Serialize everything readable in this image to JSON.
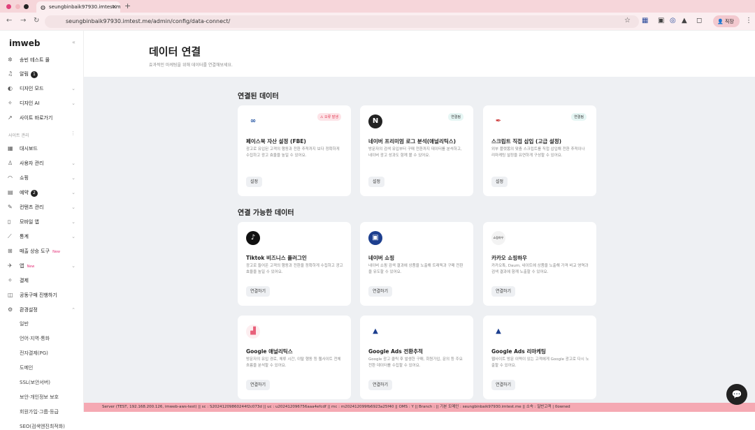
{
  "browser": {
    "tab_title": "seungbinbaik97930.imtest.me",
    "url": "seungbinbaik97930.imtest.me/admin/config/data-connect/",
    "profile": "직장"
  },
  "sidebar": {
    "logo": "imweb",
    "top_items": [
      {
        "label": "송빈 테스트 몰",
        "icon": "flag-icon"
      },
      {
        "label": "알림",
        "badge": "1",
        "icon": "bell-icon"
      },
      {
        "label": "디자인 모드",
        "icon": "palette-icon"
      },
      {
        "label": "디자인 AI",
        "icon": "sparkle-icon"
      },
      {
        "label": "사이트 바로가기",
        "icon": "external-link-icon"
      }
    ],
    "section_label": "사이트 관리",
    "items": [
      {
        "label": "대시보드"
      },
      {
        "label": "사용자 관리"
      },
      {
        "label": "쇼핑"
      },
      {
        "label": "예약",
        "badge": "2"
      },
      {
        "label": "컨텐츠 관리"
      },
      {
        "label": "모바일 앱"
      },
      {
        "label": "통계"
      },
      {
        "label": "매출 상승 도구",
        "tag": "New"
      },
      {
        "label": "앱",
        "tag": "New"
      },
      {
        "label": "결제"
      },
      {
        "label": "공동구매 진행하기"
      },
      {
        "label": "환경설정"
      }
    ],
    "sub_items": [
      "일반",
      "언어·지역·통화",
      "전자결제(PG)",
      "도메인",
      "SSL(보안서버)",
      "보안·개인정보 보호",
      "회원가입·그룹·등급",
      "SEO(검색엔진최적화)"
    ]
  },
  "header": {
    "title": "데이터 연결",
    "subtitle": "효과적인 마케팅을 위해 데이터를 연결해보세요."
  },
  "connected": {
    "title": "연결된 데이터",
    "cards": [
      {
        "name": "페이스북 자산 설정 (FBE)",
        "desc": "광고로 유입된 고객의 행동과 전환 추적까지 보다 정확하게 수집하고 광고 효율을 높일 수 있어요.",
        "status": "오류 발생",
        "button": "설정"
      },
      {
        "name": "네이버 프리미엄 로그 분석(애널리틱스)",
        "desc": "방문자의 검색 유입부터 구매 전환까지 데이터를 분석하고, 네이버 광고 성과도 함께 볼 수 있어요.",
        "status": "연결됨",
        "button": "설정"
      },
      {
        "name": "스크립트 직접 삽입 (고급 설정)",
        "desc": "외부 플랫폼의 맞춤 스크립트를 직접 삽입해 전환 추적이나 리마케팅 설정을 유연하게 구성할 수 있어요.",
        "status": "연결됨",
        "button": "설정"
      }
    ]
  },
  "available": {
    "title": "연결 가능한 데이터",
    "cards": [
      {
        "name": "Tiktok 비즈니스 플러그인",
        "desc": "광고로 들어온 고객의 행동과 전환을 정확하게 수집하고 광고 효율을 높일 수 있어요.",
        "button": "연결하기"
      },
      {
        "name": "네이버 쇼핑",
        "desc": "네이버 쇼핑 검색 결과에 상품을 노출해 트래픽과 구매 전환을 유도할 수 있어요.",
        "button": "연결하기"
      },
      {
        "name": "카카오 쇼핑하우",
        "logo_text": "쇼핑하우",
        "desc": "카카오톡, Daum, 네이트에 상품을 노출해 가격 비교 영역과 검색 결과에 함께 노출할 수 있어요.",
        "button": "연결하기"
      },
      {
        "name": "Google 애널리틱스",
        "desc": "방문자의 유입 경로, 체류 시간, 이탈 행동 등 웹사이트 전체 흐름을 분석할 수 있어요.",
        "button": "연결하기"
      },
      {
        "name": "Google Ads 전환추적",
        "desc": "Google 광고 클릭 후 발생한 구매, 회원가입, 문의 등 주요 전환 데이터를 수집할 수 있어요.",
        "button": "연결하기"
      },
      {
        "name": "Google Ads 리마케팅",
        "desc": "웹사이트 방문 이력이 있는 고객에게 Google 광고로 다시 노출할 수 있어요.",
        "button": "연결하기"
      }
    ]
  },
  "footer": "Server (TEST, 192.168.200.126, imweb-aws-test) || sc : S20241209860244f2c073d || uc : u202412096756aaa4efcdf || mc : m202412099fb6923a25f40 || OMS : Y || Branch : || 기본 도메인 : seungbinbaik97930.imtest.me || 소속 : 일반고객 | 0owned"
}
